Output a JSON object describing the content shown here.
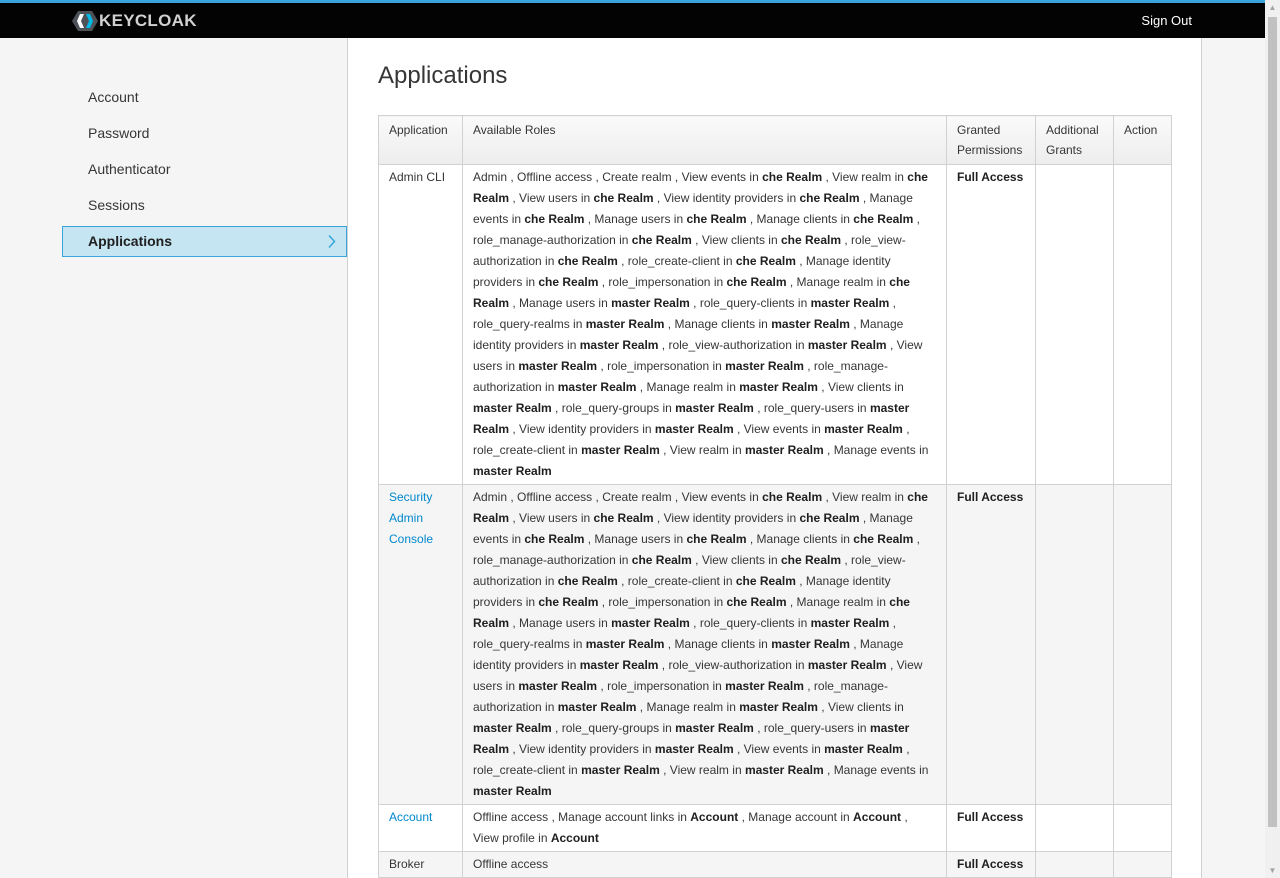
{
  "header": {
    "logo_text": "KEYCLOAK",
    "signout_label": "Sign Out"
  },
  "colors": {
    "accent": "#39a5dc",
    "navbar": "#030303",
    "active_bg": "#c5e5f3",
    "link": "#0088ce"
  },
  "sidebar": {
    "items": [
      {
        "label": "Account"
      },
      {
        "label": "Password"
      },
      {
        "label": "Authenticator"
      },
      {
        "label": "Sessions"
      },
      {
        "label": "Applications",
        "active": true
      }
    ]
  },
  "main": {
    "title": "Applications",
    "table": {
      "headers": [
        "Application",
        "Available Roles",
        "Granted Permissions",
        "Additional Grants",
        "Action"
      ],
      "rows": [
        {
          "name": "Admin CLI",
          "link": false,
          "roles": [
            [
              "Admin"
            ],
            [
              "Offline access"
            ],
            [
              "Create realm"
            ],
            [
              "View events",
              "che Realm"
            ],
            [
              "View realm",
              "che Realm"
            ],
            [
              "View users",
              "che Realm"
            ],
            [
              "View identity providers",
              "che Realm"
            ],
            [
              "Manage events",
              "che Realm"
            ],
            [
              "Manage users",
              "che Realm"
            ],
            [
              "Manage clients",
              "che Realm"
            ],
            [
              "role_manage-authorization",
              "che Realm"
            ],
            [
              "View clients",
              "che Realm"
            ],
            [
              "role_view-authorization",
              "che Realm"
            ],
            [
              "role_create-client",
              "che Realm"
            ],
            [
              "Manage identity providers",
              "che Realm"
            ],
            [
              "role_impersonation",
              "che Realm"
            ],
            [
              "Manage realm",
              "che Realm"
            ],
            [
              "Manage users",
              "master Realm"
            ],
            [
              "role_query-clients",
              "master Realm"
            ],
            [
              "role_query-realms",
              "master Realm"
            ],
            [
              "Manage clients",
              "master Realm"
            ],
            [
              "Manage identity providers",
              "master Realm"
            ],
            [
              "role_view-authorization",
              "master Realm"
            ],
            [
              "View users",
              "master Realm"
            ],
            [
              "role_impersonation",
              "master Realm"
            ],
            [
              "role_manage-authorization",
              "master Realm"
            ],
            [
              "Manage realm",
              "master Realm"
            ],
            [
              "View clients",
              "master Realm"
            ],
            [
              "role_query-groups",
              "master Realm"
            ],
            [
              "role_query-users",
              "master Realm"
            ],
            [
              "View identity providers",
              "master Realm"
            ],
            [
              "View events",
              "master Realm"
            ],
            [
              "role_create-client",
              "master Realm"
            ],
            [
              "View realm",
              "master Realm"
            ],
            [
              "Manage events",
              "master Realm"
            ]
          ],
          "granted": "Full Access",
          "additional": "",
          "action": ""
        },
        {
          "name": "Security Admin Console",
          "link": true,
          "roles": [
            [
              "Admin"
            ],
            [
              "Offline access"
            ],
            [
              "Create realm"
            ],
            [
              "View events",
              "che Realm"
            ],
            [
              "View realm",
              "che Realm"
            ],
            [
              "View users",
              "che Realm"
            ],
            [
              "View identity providers",
              "che Realm"
            ],
            [
              "Manage events",
              "che Realm"
            ],
            [
              "Manage users",
              "che Realm"
            ],
            [
              "Manage clients",
              "che Realm"
            ],
            [
              "role_manage-authorization",
              "che Realm"
            ],
            [
              "View clients",
              "che Realm"
            ],
            [
              "role_view-authorization",
              "che Realm"
            ],
            [
              "role_create-client",
              "che Realm"
            ],
            [
              "Manage identity providers",
              "che Realm"
            ],
            [
              "role_impersonation",
              "che Realm"
            ],
            [
              "Manage realm",
              "che Realm"
            ],
            [
              "Manage users",
              "master Realm"
            ],
            [
              "role_query-clients",
              "master Realm"
            ],
            [
              "role_query-realms",
              "master Realm"
            ],
            [
              "Manage clients",
              "master Realm"
            ],
            [
              "Manage identity providers",
              "master Realm"
            ],
            [
              "role_view-authorization",
              "master Realm"
            ],
            [
              "View users",
              "master Realm"
            ],
            [
              "role_impersonation",
              "master Realm"
            ],
            [
              "role_manage-authorization",
              "master Realm"
            ],
            [
              "Manage realm",
              "master Realm"
            ],
            [
              "View clients",
              "master Realm"
            ],
            [
              "role_query-groups",
              "master Realm"
            ],
            [
              "role_query-users",
              "master Realm"
            ],
            [
              "View identity providers",
              "master Realm"
            ],
            [
              "View events",
              "master Realm"
            ],
            [
              "role_create-client",
              "master Realm"
            ],
            [
              "View realm",
              "master Realm"
            ],
            [
              "Manage events",
              "master Realm"
            ]
          ],
          "granted": "Full Access",
          "additional": "",
          "action": ""
        },
        {
          "name": "Account",
          "link": true,
          "roles": [
            [
              "Offline access"
            ],
            [
              "Manage account links",
              "Account"
            ],
            [
              "Manage account",
              "Account"
            ],
            [
              "View profile",
              "Account"
            ]
          ],
          "granted": "Full Access",
          "additional": "",
          "action": ""
        },
        {
          "name": "Broker",
          "link": false,
          "roles": [
            [
              "Offline access"
            ]
          ],
          "granted": "Full Access",
          "additional": "",
          "action": ""
        }
      ]
    }
  }
}
